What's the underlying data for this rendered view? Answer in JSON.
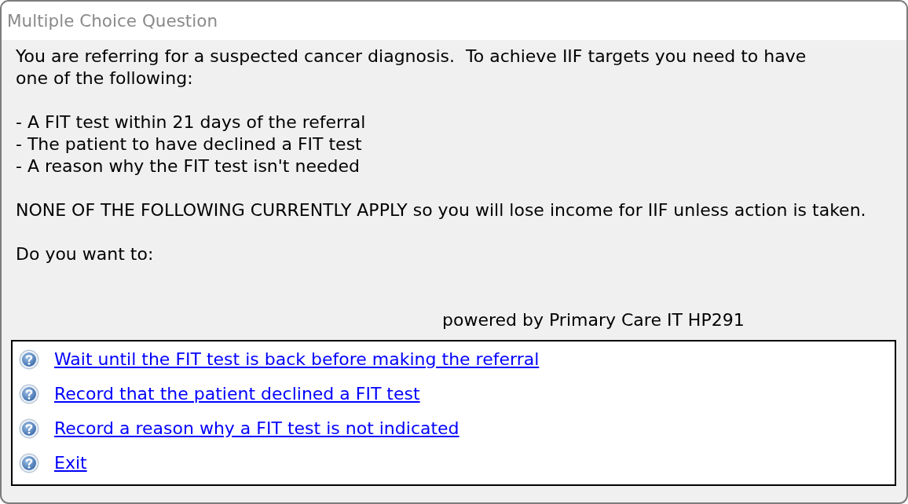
{
  "window": {
    "title": "Multiple Choice Question"
  },
  "message": {
    "intro": "You are referring for a suspected cancer diagnosis.  To achieve IIF targets you need to have\none of the following:",
    "bullets": [
      "- A FIT test within 21 days of the referral",
      "- The patient to have declined a FIT test",
      "- A reason why the FIT test isn't needed"
    ],
    "warning": "NONE OF THE FOLLOWING CURRENTLY APPLY so you will lose income for IIF unless action is taken.",
    "prompt": "Do you want to:"
  },
  "footer": "powered by Primary Care IT HP291",
  "options": [
    {
      "label": "Wait until the FIT test is back before making the referral"
    },
    {
      "label": "Record that the patient declined a FIT test"
    },
    {
      "label": "Record a reason why a FIT test is not indicated"
    },
    {
      "label": "Exit"
    }
  ]
}
